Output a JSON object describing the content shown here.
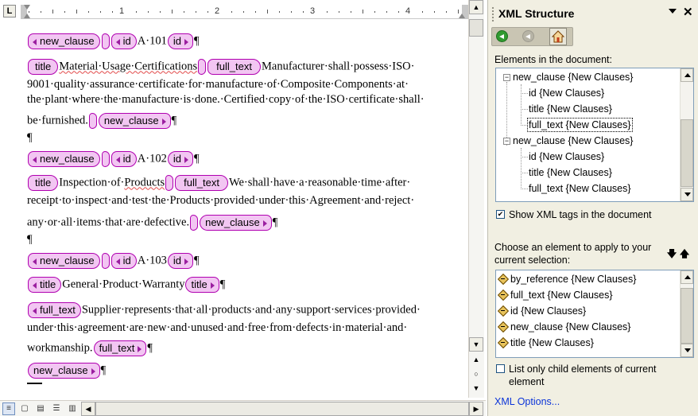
{
  "ruler": {
    "corner": "L",
    "numbers": [
      "1",
      "2",
      "3",
      "4"
    ]
  },
  "document": {
    "pilcrow": "¶",
    "tags": {
      "new_clause": "new_clause",
      "id": "id",
      "title": "title",
      "full_text": "full_text"
    },
    "clause1": {
      "id": "A·101",
      "title": "Material·Usage·Certifications",
      "text_line1": [
        "Manufacturer·shall·possess·ISO·"
      ],
      "text_line2": "9001·quality·assurance·certificate·for·manufacture·of·Composite·Components·at·",
      "text_line3": "the·plant·where·the·manufacture·is·done.·Certified·copy·of·the·ISO·certificate·shall·",
      "text_line4": "be·furnished."
    },
    "clause2": {
      "id": "A·102",
      "title_pre": "Inspection·of·",
      "title_sq": "Products",
      "text_line1": "We·shall·have·a·reasonable·time·after·",
      "text_line2": "receipt·to·inspect·and·test·the·Products·provided·under·this·Agreement·and·reject·",
      "text_line3": "any·or·all·items·that·are·defective."
    },
    "clause3": {
      "id": "A·103",
      "title": "General·Product·Warranty",
      "text_line1": "Supplier·represents·that·all·products·and·any·support·services·provided·",
      "text_line2": "under·this·agreement·are·new·and·unused·and·free·from·defects·in·material·and·",
      "text_line3": "workmanship."
    }
  },
  "task_pane": {
    "title": "XML Structure",
    "close": "✕",
    "elements_label": "Elements in the document:",
    "tree": [
      {
        "label": "new_clause {New Clauses}",
        "level": 0
      },
      {
        "label": "id {New Clauses}",
        "level": 1
      },
      {
        "label": "title {New Clauses}",
        "level": 1
      },
      {
        "label": "full_text {New Clauses}",
        "level": 1,
        "selected": true
      },
      {
        "label": "new_clause {New Clauses}",
        "level": 0
      },
      {
        "label": "id {New Clauses}",
        "level": 1
      },
      {
        "label": "title {New Clauses}",
        "level": 1
      },
      {
        "label": "full_text {New Clauses}",
        "level": 1
      }
    ],
    "show_tags_label": "Show XML tags in the document",
    "show_tags_checked": true,
    "choose_label_line1": "Choose an element to apply to your",
    "choose_label_line2": "current selection:",
    "elements": [
      "by_reference {New Clauses}",
      "full_text {New Clauses}",
      "id {New Clauses}",
      "new_clause {New Clauses}",
      "title {New Clauses}"
    ],
    "list_only_line1": "List only child elements of current",
    "list_only_line2": "element",
    "list_only_checked": false,
    "xml_options": "XML Options..."
  },
  "colors": {
    "tag_fill": "#f2c6f2",
    "tag_border": "#b000b0",
    "link": "#0b34d8",
    "pane_bg": "#f1efe2"
  }
}
